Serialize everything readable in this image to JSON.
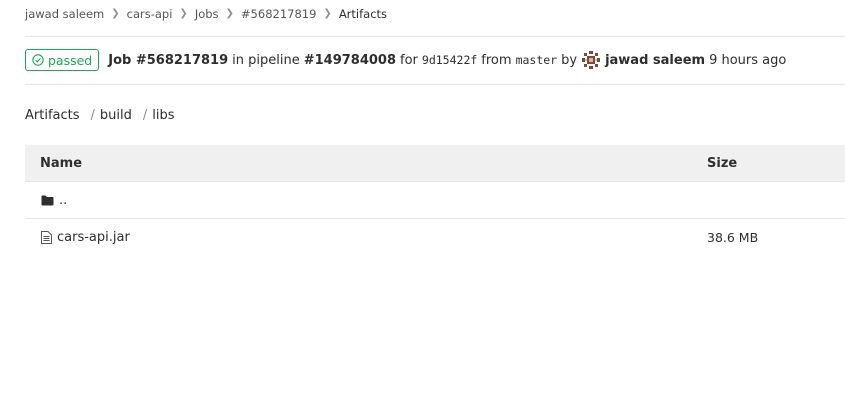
{
  "breadcrumb": [
    "jawad saleem",
    "cars-api",
    "Jobs",
    "#568217819",
    "Artifacts"
  ],
  "job": {
    "status": "passed",
    "job_label": "Job #568217819",
    "in_pipeline": "in pipeline",
    "pipeline": "#149784008",
    "for_text": "for",
    "commit": "9d15422f",
    "from_text": "from",
    "branch": "master",
    "by_text": "by",
    "user": "jawad saleem",
    "time": "9 hours ago"
  },
  "path": [
    "Artifacts",
    "build",
    "libs"
  ],
  "table": {
    "headers": {
      "name": "Name",
      "size": "Size"
    },
    "rows": [
      {
        "name": "..",
        "size": "",
        "icon": "folder-icon"
      },
      {
        "name": "cars-api.jar",
        "size": "38.6 MB",
        "icon": "file-icon"
      }
    ]
  },
  "colors": {
    "success": "#1aaa55",
    "text": "#2e2e2e",
    "header_bg": "#f0f0f0"
  }
}
